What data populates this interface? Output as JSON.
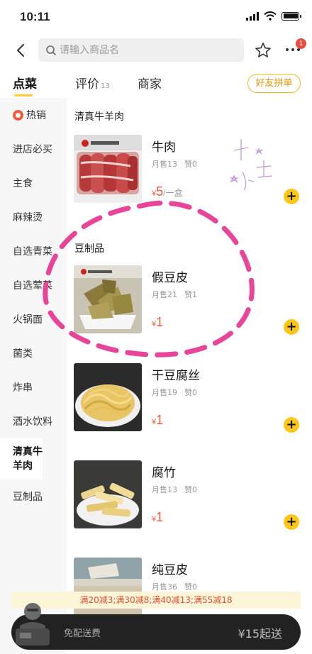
{
  "status_bar": {
    "time": "10:11"
  },
  "search": {
    "placeholder": "请输入商品名"
  },
  "nav": {
    "notification_count": "1"
  },
  "tabs": [
    {
      "label": "点菜",
      "count": ""
    },
    {
      "label": "评价",
      "count": "13"
    },
    {
      "label": "商家",
      "count": ""
    }
  ],
  "invite_button": "好友拼单",
  "sidebar": {
    "items": [
      {
        "label": "热销"
      },
      {
        "label": "进店必买"
      },
      {
        "label": "主食"
      },
      {
        "label": "麻辣烫"
      },
      {
        "label": "自选青菜"
      },
      {
        "label": "自选荤菜"
      },
      {
        "label": "火锅面"
      },
      {
        "label": "菌类"
      },
      {
        "label": "炸串"
      },
      {
        "label": "酒水饮料"
      },
      {
        "label": "清真牛羊肉"
      },
      {
        "label": "豆制品"
      }
    ]
  },
  "sections": [
    {
      "title": "清真牛羊肉"
    },
    {
      "title": "豆制品"
    }
  ],
  "products": [
    {
      "name": "牛肉",
      "sales": "月售13",
      "likes": "赞0",
      "price": "5",
      "currency": "¥",
      "unit": "/一盒"
    },
    {
      "name": "假豆皮",
      "sales": "月售21",
      "likes": "赞1",
      "price": "1",
      "currency": "¥",
      "unit": ""
    },
    {
      "name": "干豆腐丝",
      "sales": "月售19",
      "likes": "赞0",
      "price": "1",
      "currency": "¥",
      "unit": ""
    },
    {
      "name": "腐竹",
      "sales": "月售13",
      "likes": "赞0",
      "price": "1",
      "currency": "¥",
      "unit": ""
    },
    {
      "name": "纯豆皮",
      "sales": "月售36",
      "likes": "赞0",
      "price": "",
      "currency": "",
      "unit": ""
    }
  ],
  "promo": "满20减3;满30减8;满40减13;满55减18",
  "cart": {
    "delivery": "免配送费",
    "minimum": "¥15起送"
  },
  "colors": {
    "accent": "#ffc61a",
    "price": "#f2573c",
    "annotation": "#e8459a"
  }
}
